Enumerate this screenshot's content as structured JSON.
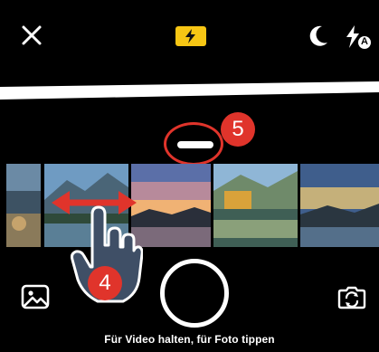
{
  "toolbar": {
    "close_icon": "close-icon",
    "flash_icon": "flash-bolt-icon",
    "night_icon": "moon-icon",
    "flash_auto_icon": "flash-auto-icon",
    "flash_auto_label": "A"
  },
  "annotations": {
    "step_5": "5",
    "step_4": "4"
  },
  "camera": {
    "hint": "Für Video halten, für Foto tippen",
    "gallery_icon": "image-gallery-icon",
    "switch_icon": "switch-camera-icon"
  },
  "colors": {
    "accent_yellow": "#f7c614",
    "annotation_red": "#e0342b",
    "hand_blue": "#3f4f66"
  }
}
